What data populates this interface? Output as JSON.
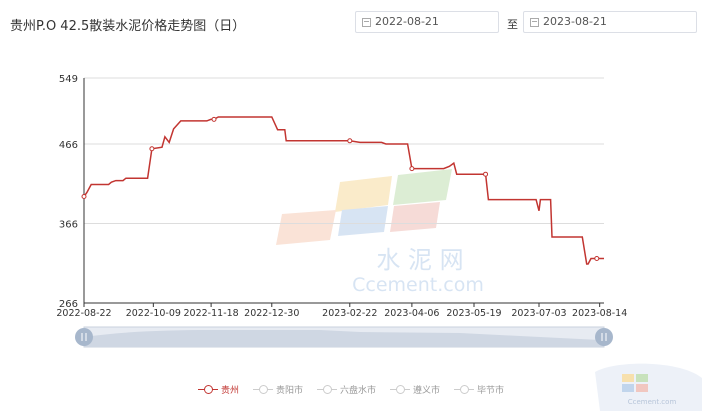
{
  "header": {
    "title": "贵州P.O 42.5散装水泥价格走势图（日）",
    "start_date": "2022-08-21",
    "to_label": "至",
    "end_date": "2023-08-21"
  },
  "watermark": {
    "cn": "水 泥 网",
    "en": "Ccement.com"
  },
  "colors": {
    "series": "#c23531",
    "axis": "#333333",
    "grid": "#dddddd"
  },
  "legend": [
    {
      "label": "贵州",
      "active": true
    },
    {
      "label": "贵阳市",
      "active": false
    },
    {
      "label": "六盘水市",
      "active": false
    },
    {
      "label": "遵义市",
      "active": false
    },
    {
      "label": "毕节市",
      "active": false
    }
  ],
  "chart_data": {
    "type": "line",
    "title": "贵州P.O 42.5散装水泥价格走势图（日）",
    "ylim": [
      266,
      549
    ],
    "yticks": [
      266,
      366,
      466,
      549
    ],
    "xlim": [
      "2022-08-22",
      "2023-08-17"
    ],
    "xticks": [
      "2022-08-22",
      "2022-10-09",
      "2022-11-18",
      "2022-12-30",
      "2023-02-22",
      "2023-04-06",
      "2023-05-19",
      "2023-07-03",
      "2023-08-14"
    ],
    "grid": true,
    "legend_position": "bottom",
    "series": [
      {
        "name": "贵州",
        "points": [
          [
            "2022-08-22",
            400
          ],
          [
            "2022-08-24",
            405
          ],
          [
            "2022-08-27",
            415
          ],
          [
            "2022-09-08",
            415
          ],
          [
            "2022-09-10",
            418
          ],
          [
            "2022-09-13",
            420
          ],
          [
            "2022-09-18",
            420
          ],
          [
            "2022-09-20",
            423
          ],
          [
            "2022-10-05",
            423
          ],
          [
            "2022-10-08",
            460
          ],
          [
            "2022-10-15",
            462
          ],
          [
            "2022-10-17",
            475
          ],
          [
            "2022-10-20",
            468
          ],
          [
            "2022-10-23",
            485
          ],
          [
            "2022-10-28",
            495
          ],
          [
            "2022-11-15",
            495
          ],
          [
            "2022-11-18",
            497
          ],
          [
            "2022-11-20",
            497
          ],
          [
            "2022-11-23",
            500
          ],
          [
            "2022-12-30",
            500
          ],
          [
            "2023-01-03",
            484
          ],
          [
            "2023-01-08",
            484
          ],
          [
            "2023-01-09",
            470
          ],
          [
            "2023-02-22",
            470
          ],
          [
            "2023-03-01",
            468
          ],
          [
            "2023-03-16",
            468
          ],
          [
            "2023-03-19",
            466
          ],
          [
            "2023-04-03",
            466
          ],
          [
            "2023-04-06",
            435
          ],
          [
            "2023-04-28",
            435
          ],
          [
            "2023-05-02",
            438
          ],
          [
            "2023-05-05",
            442
          ],
          [
            "2023-05-07",
            428
          ],
          [
            "2023-05-27",
            428
          ],
          [
            "2023-05-29",
            396
          ],
          [
            "2023-07-01",
            396
          ],
          [
            "2023-07-03",
            382
          ],
          [
            "2023-07-04",
            396
          ],
          [
            "2023-07-11",
            396
          ],
          [
            "2023-07-12",
            349
          ],
          [
            "2023-08-02",
            349
          ],
          [
            "2023-08-05",
            315
          ],
          [
            "2023-08-06",
            315
          ],
          [
            "2023-08-08",
            322
          ],
          [
            "2023-08-17",
            322
          ]
        ]
      }
    ],
    "markers": [
      [
        "2022-08-22",
        400
      ],
      [
        "2022-10-08",
        460
      ],
      [
        "2022-11-20",
        497
      ],
      [
        "2023-02-22",
        470
      ],
      [
        "2023-04-06",
        435
      ],
      [
        "2023-05-27",
        428
      ],
      [
        "2023-08-12",
        322
      ]
    ]
  }
}
